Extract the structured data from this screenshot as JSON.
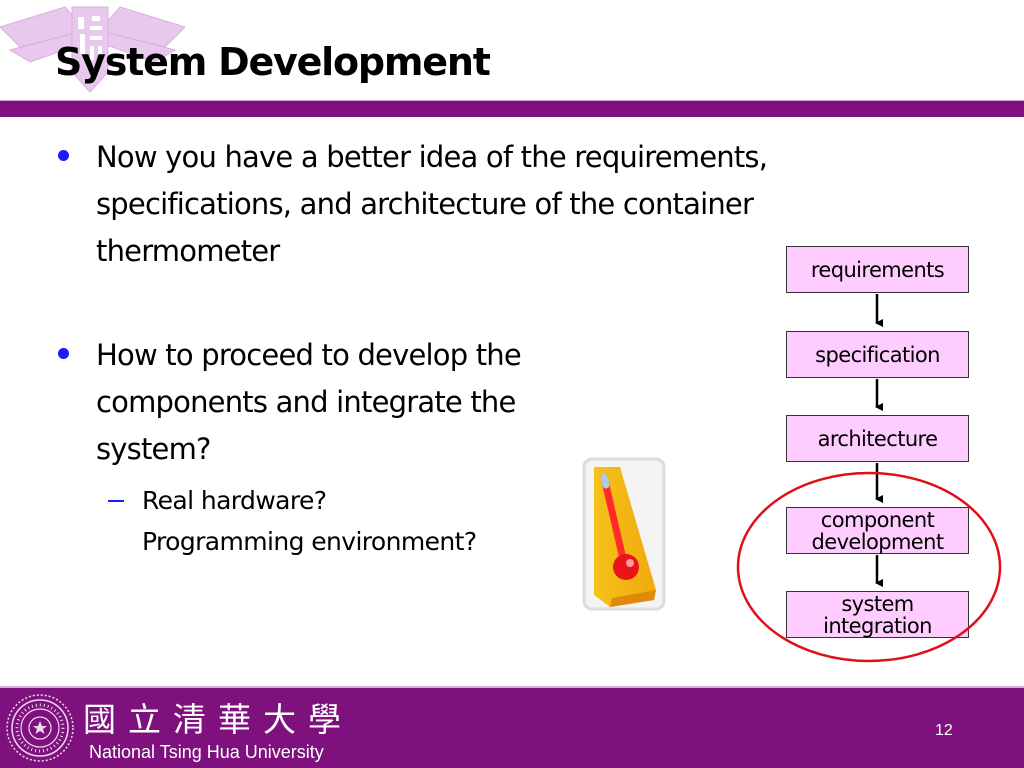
{
  "slide": {
    "title": "System Development",
    "page_number": "12"
  },
  "bullets": [
    {
      "text": "Now you have a better idea of the requirements, specifications, and architecture of the container thermometer"
    },
    {
      "text": "How to proceed to develop the components and integrate the system?"
    }
  ],
  "sub_bullets": [
    {
      "line1": "Real hardware?",
      "line2": "Programming environment?"
    }
  ],
  "flowchart": {
    "steps": [
      {
        "label": "requirements"
      },
      {
        "label": "specification"
      },
      {
        "label": "architecture"
      },
      {
        "label_line1": "component",
        "label_line2": "development"
      },
      {
        "label_line1": "system",
        "label_line2": "integration"
      }
    ],
    "highlight": "component development and system integration circled in red"
  },
  "footer": {
    "university_chinese": "國立清華大學",
    "university_english": "National Tsing Hua University"
  },
  "colors": {
    "brand_purple": "#7f117f",
    "box_fill": "#ffccff",
    "bullet_blue": "#1a1aff",
    "highlight_red": "#e0101a"
  },
  "icons": {
    "logo": "nthu-logo-watermark",
    "image": "thermometer-icon",
    "seal": "nthu-seal-icon"
  }
}
